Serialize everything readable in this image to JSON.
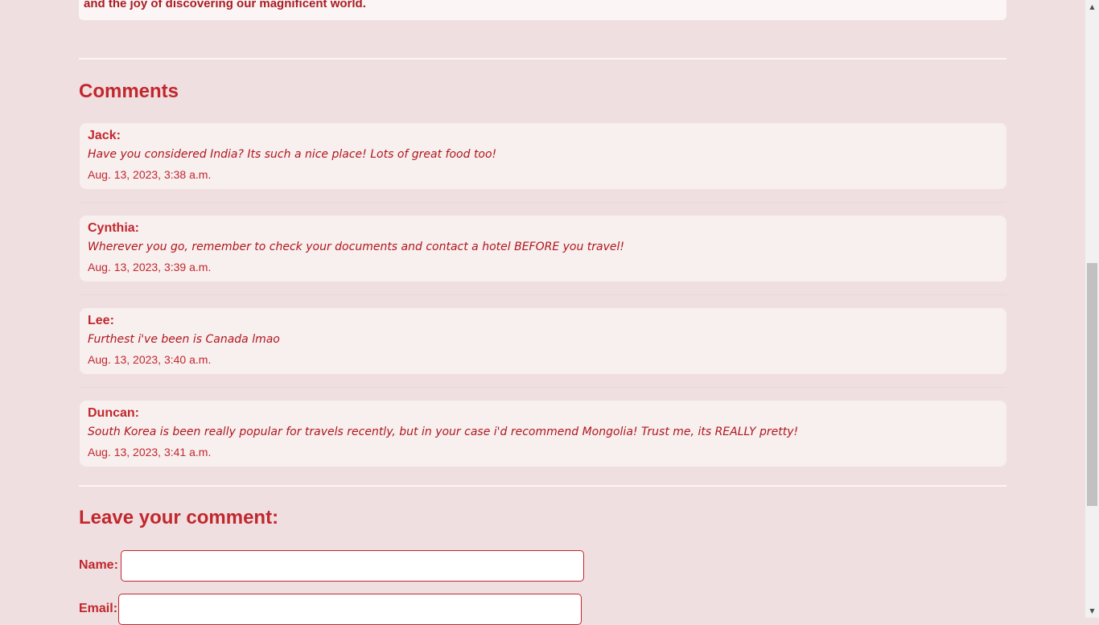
{
  "post": {
    "closing_text": "and the joy of discovering our magnificent world."
  },
  "comments_section": {
    "title": "Comments",
    "comments": [
      {
        "author": "Jack:",
        "text": "Have you considered India? Its such a nice place! Lots of great food too!",
        "date": "Aug. 13, 2023, 3:38 a.m."
      },
      {
        "author": "Cynthia:",
        "text": "Wherever you go, remember to check your documents and contact a hotel BEFORE you travel!",
        "date": "Aug. 13, 2023, 3:39 a.m."
      },
      {
        "author": "Lee:",
        "text": "Furthest i've been is Canada lmao",
        "date": "Aug. 13, 2023, 3:40 a.m."
      },
      {
        "author": "Duncan:",
        "text": "South Korea is been really popular for travels recently, but in your case i'd recommend Mongolia! Trust me, its REALLY pretty!",
        "date": "Aug. 13, 2023, 3:41 a.m."
      }
    ]
  },
  "comment_form": {
    "title": "Leave your comment:",
    "name_label": "Name:",
    "name_value": "",
    "email_label": "Email:",
    "email_value": ""
  },
  "scrollbar": {
    "up_arrow_icon": "triangle-up",
    "down_arrow_icon": "triangle-down"
  },
  "theme": {
    "accent": "#c1272d",
    "background": "#f0dfe0",
    "card_background": "#f8efef"
  }
}
